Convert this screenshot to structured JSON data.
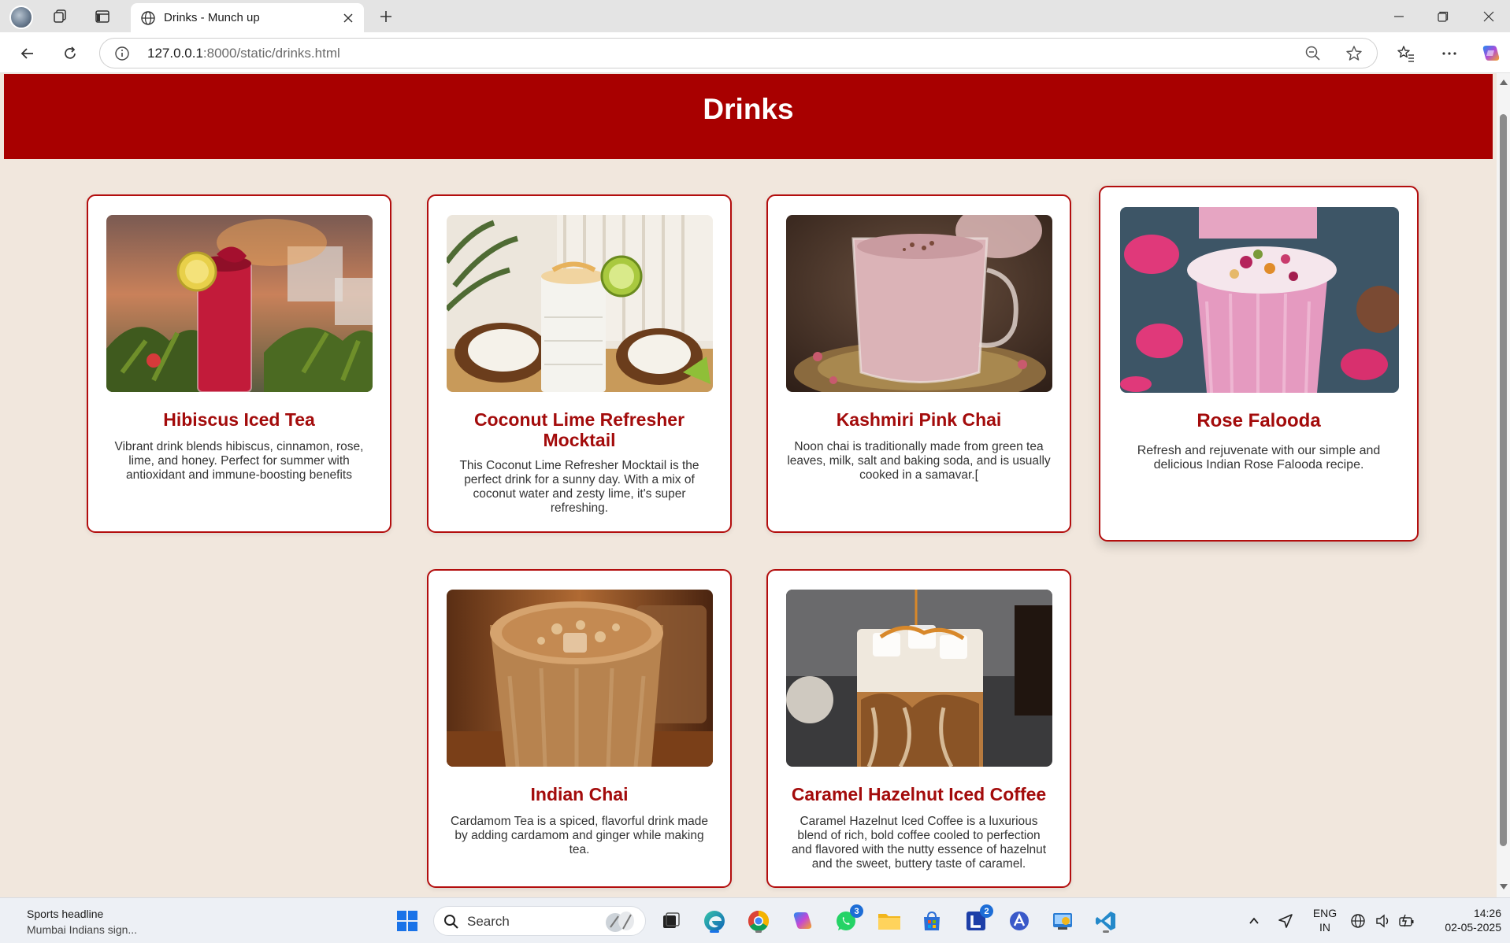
{
  "browser": {
    "tab_title": "Drinks - Munch up",
    "url_host": "127.0.0.1",
    "url_rest": ":8000/static/drinks.html"
  },
  "page": {
    "heading": "Drinks",
    "colors": {
      "header_bg": "#a80000",
      "page_bg": "#f1e7dd",
      "accent": "#a30b0b"
    }
  },
  "drinks": [
    {
      "name": "Hibiscus Iced Tea",
      "description": "Vibrant drink blends hibiscus, cinnamon, rose, lime, and honey. Perfect for summer with antioxidant and immune-boosting benefits",
      "image": "hibiscus-iced-tea-photo"
    },
    {
      "name": "Coconut Lime Refresher Mocktail",
      "description": "This Coconut Lime Refresher Mocktail is the perfect drink for a sunny day. With a mix of coconut water and zesty lime, it's super refreshing.",
      "image": "coconut-lime-mocktail-photo"
    },
    {
      "name": "Kashmiri Pink Chai",
      "description": "Noon chai is traditionally made from green tea leaves, milk, salt and baking soda, and is usually cooked in a samavar.[",
      "image": "kashmiri-pink-chai-photo"
    },
    {
      "name": "Rose Falooda",
      "description": "Refresh and rejuvenate with our simple and delicious Indian Rose Falooda recipe.",
      "image": "rose-falooda-photo"
    },
    {
      "name": "Indian Chai",
      "description": "Cardamom Tea is a spiced, flavorful drink made by adding cardamom and ginger while making tea.",
      "image": "indian-chai-photo"
    },
    {
      "name": "Caramel Hazelnut Iced Coffee",
      "description": "Caramel Hazelnut Iced Coffee is a luxurious blend of rich, bold coffee cooled to perfection and flavored with the nutty essence of hazelnut and the sweet, buttery taste of caramel.",
      "image": "caramel-hazelnut-iced-coffee-photo"
    }
  ],
  "taskbar": {
    "news_headline": "Sports headline",
    "news_subline": "Mumbai Indians sign...",
    "search_label": "Search",
    "whatsapp_badge": "3",
    "lens_badge": "2",
    "lang_top": "ENG",
    "lang_bottom": "IN",
    "time": "14:26",
    "date": "02-05-2025"
  }
}
